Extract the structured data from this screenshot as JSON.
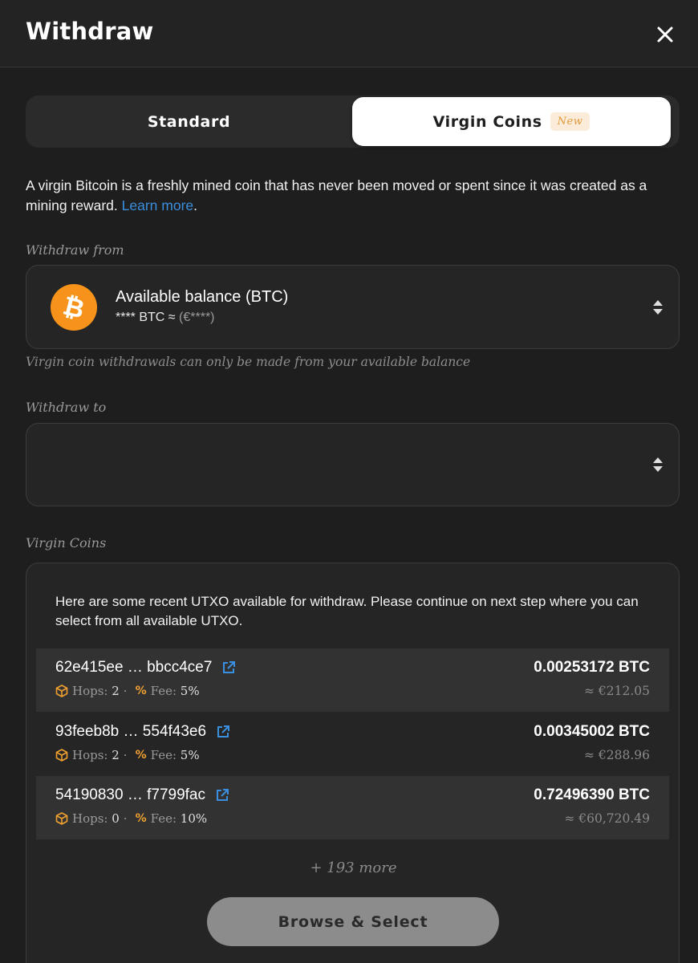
{
  "header": {
    "title": "Withdraw"
  },
  "tabs": {
    "standard_label": "Standard",
    "virgin_label": "Virgin Coins",
    "virgin_badge": "New"
  },
  "description": {
    "text": "A virgin Bitcoin is a freshly mined coin that has never been moved or spent since it was created as a mining reward. ",
    "link": "Learn more",
    "end": "."
  },
  "withdraw_from": {
    "label": "Withdraw from",
    "title": "Available balance (BTC)",
    "amount": "**** BTC ≈ ",
    "fiat": "(€****)",
    "helper": "Virgin coin withdrawals can only be made from your available balance"
  },
  "withdraw_to": {
    "label": "Withdraw to",
    "value": ""
  },
  "virgin_coins": {
    "label": "Virgin Coins",
    "intro": "Here are some recent UTXO available for withdraw. Please continue on next step where you can select from all available UTXO.",
    "hops_label": "Hops:",
    "fee_label": "Fee:",
    "utxos": [
      {
        "id": "62e415ee … bbcc4ce7",
        "hops": "2",
        "fee": "5%",
        "amount": "0.00253172 BTC",
        "fiat": "≈ €212.05"
      },
      {
        "id": "93feeb8b … 554f43e6",
        "hops": "2",
        "fee": "5%",
        "amount": "0.00345002 BTC",
        "fiat": "≈ €288.96"
      },
      {
        "id": "54190830 … f7799fac",
        "hops": "0",
        "fee": "10%",
        "amount": "0.72496390 BTC",
        "fiat": "≈ €60,720.49"
      }
    ],
    "more": "+ 193 more",
    "browse_button": "Browse & Select"
  },
  "colors": {
    "background": "#1e1e1e",
    "accent_orange": "#f7931a",
    "link_blue": "#3a8fe0"
  },
  "icons": {
    "close": "close-icon",
    "bitcoin": "bitcoin-icon",
    "selector": "updown-chevron-icon",
    "external": "external-link-icon",
    "hops": "cube-icon",
    "fee": "percent-icon"
  }
}
